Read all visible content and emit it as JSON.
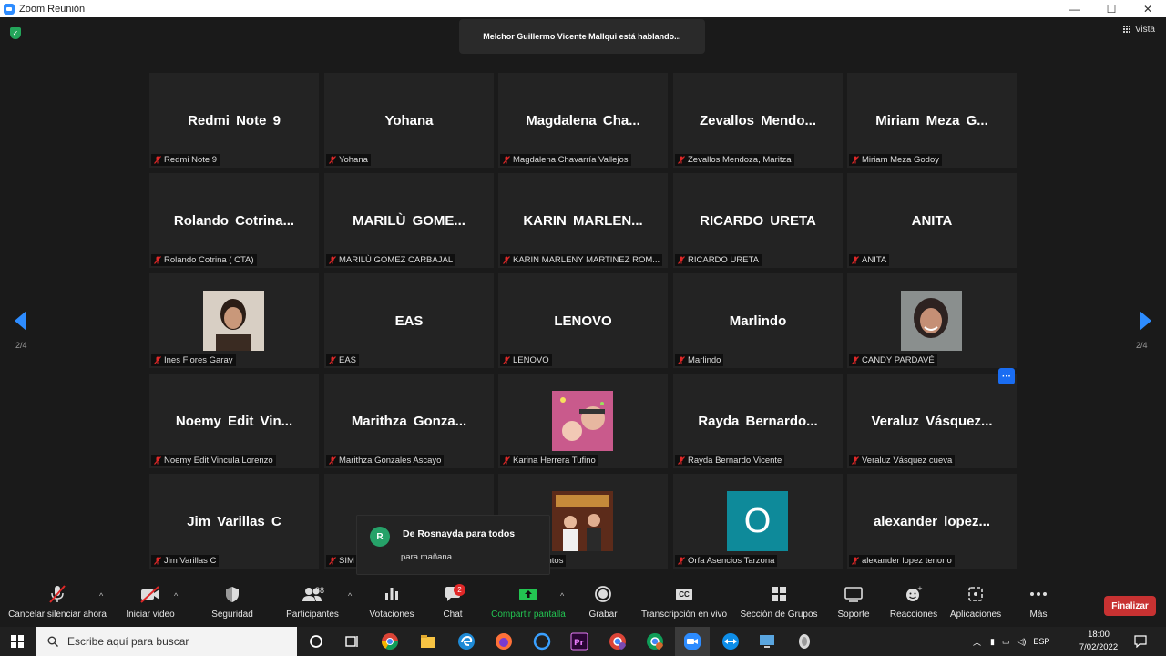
{
  "window": {
    "title": "Zoom Reunión",
    "min": "—",
    "max": "☐",
    "close": "✕"
  },
  "banner": {
    "speaking": "Melchor Guillermo Vicente Mallqui está hablando..."
  },
  "view": {
    "label": "Vista"
  },
  "pager": {
    "left": "2/4",
    "right": "2/4"
  },
  "colors": {
    "accent": "#2d8cff",
    "end": "#c83232",
    "share": "#23c552",
    "badge": "#e02828"
  },
  "tiles": [
    {
      "big": "Redmi Note 9",
      "name": "Redmi Note 9"
    },
    {
      "big": "Yohana",
      "name": "Yohana"
    },
    {
      "big": "Magdalena Cha...",
      "name": "Magdalena Chavarría Vallejos"
    },
    {
      "big": "Zevallos Mendo...",
      "name": "Zevallos Mendoza, Maritza"
    },
    {
      "big": "Miriam Meza G...",
      "name": "Miriam Meza Godoy"
    },
    {
      "big": "Rolando Cotrina...",
      "name": "Rolando Cotrina ( CTA)"
    },
    {
      "big": "MARILÙ GOME...",
      "name": "MARILÙ GOMEZ CARBAJAL"
    },
    {
      "big": "KARIN MARLEN...",
      "name": "KARIN MARLENY MARTINEZ ROM..."
    },
    {
      "big": "RICARDO URETA",
      "name": "RICARDO URETA"
    },
    {
      "big": "ANITA",
      "name": "ANITA"
    },
    {
      "big": "",
      "name": "Ines Flores Garay",
      "photo": "photo-1"
    },
    {
      "big": "EAS",
      "name": "EAS"
    },
    {
      "big": "LENOVO",
      "name": "LENOVO"
    },
    {
      "big": "Marlindo",
      "name": "Marlindo"
    },
    {
      "big": "",
      "name": "CANDY PARDAVÉ",
      "photo": "photo-2"
    },
    {
      "big": "Noemy Edit Vin...",
      "name": "Noemy Edit Vincula Lorenzo"
    },
    {
      "big": "Marithza Gonza...",
      "name": "Marithza Gonzales Ascayo"
    },
    {
      "big": "",
      "name": "Karina Herrera Tufino",
      "photo": "photo-3"
    },
    {
      "big": "Rayda Bernardo...",
      "name": "Rayda Bernardo Vicente"
    },
    {
      "big": "Veraluz Vásquez...",
      "name": "Veraluz Vásquez cueva",
      "more": "···"
    },
    {
      "big": "Jim Varillas C",
      "name": "Jim Varillas C"
    },
    {
      "big": "",
      "name": "SIM"
    },
    {
      "big": "",
      "name": "edina Santos",
      "photo": "photo-4"
    },
    {
      "big": "",
      "name": "Orfa Asencios Tarzona",
      "letter": "O"
    },
    {
      "big": "alexander lopez...",
      "name": "alexander lopez tenorio"
    }
  ],
  "chat_popup": {
    "initial": "R",
    "from": "De Rosnayda para todos",
    "message": "para mañana"
  },
  "toolbar": {
    "unmute": "Cancelar silenciar ahora",
    "video": "Iniciar video",
    "security": "Seguridad",
    "participants": "Participantes",
    "participants_count": "88",
    "polls": "Votaciones",
    "chat": "Chat",
    "chat_badge": "2",
    "share": "Compartir pantalla",
    "record": "Grabar",
    "transcript": "Transcripción en vivo",
    "rooms": "Sección de Grupos",
    "support": "Soporte",
    "reactions": "Reacciones",
    "apps": "Aplicaciones",
    "more": "Más",
    "end": "Finalizar",
    "caret": "^",
    "cc": "CC"
  },
  "taskbar": {
    "search_placeholder": "Escribe aquí para buscar",
    "lang": "ESP",
    "time": "18:00",
    "date": "7/02/2022"
  }
}
